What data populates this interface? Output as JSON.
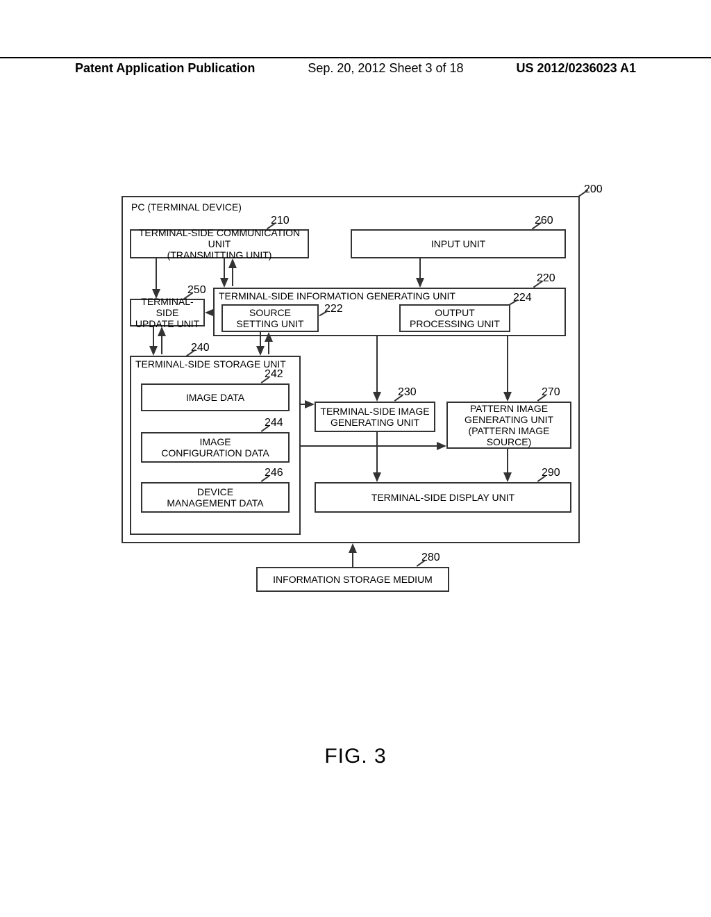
{
  "header": {
    "left": "Patent Application Publication",
    "middle": "Sep. 20, 2012  Sheet 3 of 18",
    "right": "US 2012/0236023 A1"
  },
  "figure_caption": "FIG. 3",
  "numbers": {
    "n200": "200",
    "n210": "210",
    "n260": "260",
    "n220": "220",
    "n222": "222",
    "n224": "224",
    "n250": "250",
    "n240": "240",
    "n242": "242",
    "n244": "244",
    "n246": "246",
    "n230": "230",
    "n270": "270",
    "n290": "290",
    "n280": "280"
  },
  "labels": {
    "outer": "PC (TERMINAL DEVICE)",
    "b210": "TERMINAL-SIDE COMMUNICATION UNIT\n(TRANSMITTING UNIT)",
    "b260": "INPUT UNIT",
    "b220": "TERMINAL-SIDE INFORMATION GENERATING UNIT",
    "b222": "SOURCE\nSETTING UNIT",
    "b224": "OUTPUT\nPROCESSING UNIT",
    "b250": "TERMINAL-SIDE\nUPDATE UNIT",
    "b240": "TERMINAL-SIDE STORAGE UNIT",
    "b242": "IMAGE DATA",
    "b244": "IMAGE\nCONFIGURATION DATA",
    "b246": "DEVICE\nMANAGEMENT DATA",
    "b230": "TERMINAL-SIDE IMAGE\nGENERATING UNIT",
    "b270": "PATTERN IMAGE\nGENERATING UNIT\n(PATTERN IMAGE SOURCE)",
    "b290": "TERMINAL-SIDE DISPLAY UNIT",
    "b280": "INFORMATION STORAGE MEDIUM"
  }
}
